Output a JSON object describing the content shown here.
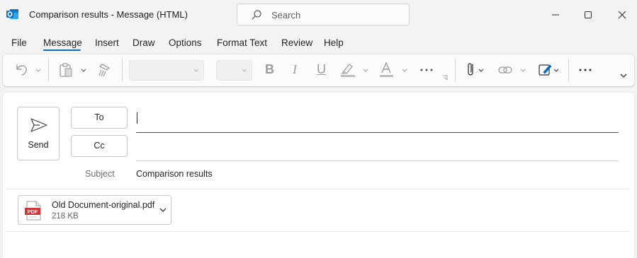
{
  "window": {
    "title": "Comparison results  -  Message (HTML)",
    "search_placeholder": "Search",
    "app_icon": "outlook-icon",
    "controls": [
      "minimize-icon",
      "maximize-icon",
      "close-icon"
    ]
  },
  "menu": {
    "tabs": [
      "File",
      "Message",
      "Insert",
      "Draw",
      "Options",
      "Format Text",
      "Review",
      "Help"
    ],
    "active": "Message"
  },
  "ribbon": {
    "font_name": "",
    "font_size": "",
    "letters": {
      "bold": "B",
      "italic": "I",
      "underline": "U",
      "font_color": "A"
    },
    "icons": [
      "undo-icon",
      "paste-icon",
      "format-painter-icon",
      "highlight-icon",
      "font-color-icon",
      "more-icon",
      "attach-file-icon",
      "link-icon",
      "signature-icon",
      "more-commands-icon",
      "expand-ribbon-icon"
    ]
  },
  "compose": {
    "send_label": "Send",
    "to_label": "To",
    "cc_label": "Cc",
    "to_value": "",
    "cc_value": "",
    "subject_label": "Subject",
    "subject_value": "Comparison results"
  },
  "attachment": {
    "name": "Old Document-original.pdf",
    "size": "218 KB",
    "icon_text": "PDF"
  },
  "colors": {
    "accent": "#0f6cbd",
    "focus_line": "#0e7a74",
    "pdf_red": "#d13438"
  }
}
